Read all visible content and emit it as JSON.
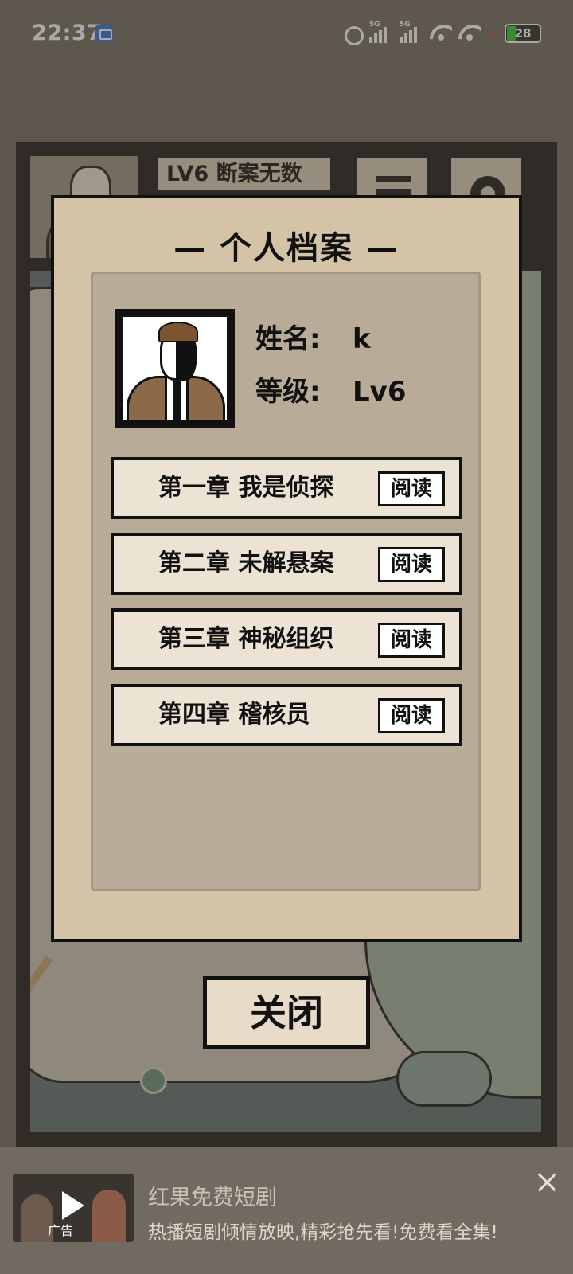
{
  "status_bar": {
    "time": "22:37",
    "net1": "5G",
    "net2": "5G",
    "battery": "28",
    "icons": [
      "screen-record-icon",
      "alarm-icon",
      "signal-5g-icon",
      "signal-5g-icon",
      "wifi-icon",
      "wifi-icon",
      "battery-warning-icon",
      "battery-icon"
    ]
  },
  "game": {
    "level_banner": "LV6  断案无数",
    "icons": [
      "portrait-icon",
      "menu-icon",
      "gear-icon",
      "tree-icon"
    ]
  },
  "dialog": {
    "title": "— 个人档案 —",
    "name_label": "姓名:",
    "name_value": "k",
    "level_label": "等级:",
    "level_value": "Lv6",
    "chapters": [
      {
        "title": "第一章 我是侦探",
        "button": "阅读"
      },
      {
        "title": "第二章 未解悬案",
        "button": "阅读"
      },
      {
        "title": "第三章 神秘组织",
        "button": "阅读"
      },
      {
        "title": "第四章 稽核员",
        "button": "阅读"
      }
    ]
  },
  "close_button": "关闭",
  "ad": {
    "tag": "广告",
    "title": "红果免费短剧",
    "description": "热播短剧倾情放映,精彩抢先看!免费看全集!",
    "icons": [
      "play-icon",
      "close-icon"
    ]
  },
  "colors": {
    "background": "#706a60",
    "dialog": "#d4c3a6",
    "panel": "#b8ab97",
    "chapter": "#ece3d4",
    "battery_fill": "#36c23a"
  }
}
